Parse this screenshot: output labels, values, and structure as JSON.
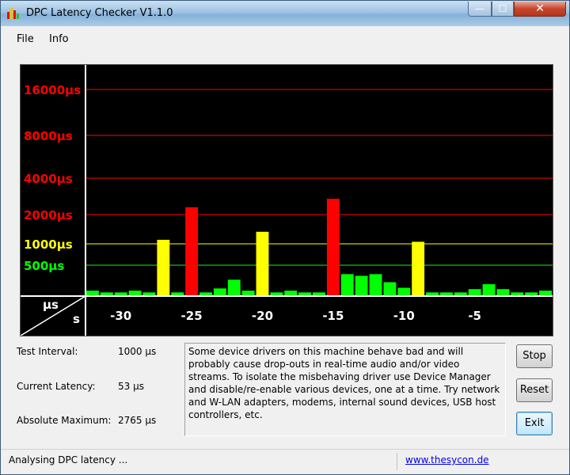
{
  "window": {
    "title": "DPC Latency Checker V1.1.0"
  },
  "window_controls": {
    "minimize": "—",
    "maximize": "☐",
    "close": "✕"
  },
  "menu": [
    "File",
    "Info"
  ],
  "chart_data": {
    "type": "bar",
    "ylabel": "µs",
    "xlabel": "s",
    "yscale": "log",
    "grid": true,
    "gridlines": [
      {
        "label": "16000µs",
        "value": 16000,
        "color": "#ff0000"
      },
      {
        "label": "8000µs",
        "value": 8000,
        "color": "#ff0000"
      },
      {
        "label": "4000µs",
        "value": 4000,
        "color": "#ff0000"
      },
      {
        "label": "2000µs",
        "value": 2000,
        "color": "#ff0000"
      },
      {
        "label": "1000µs",
        "value": 1000,
        "color": "#ffff00"
      },
      {
        "label": "500µs",
        "value": 500,
        "color": "#00ff00"
      }
    ],
    "x_ticks": [
      {
        "label": "-30",
        "value": -30
      },
      {
        "label": "-25",
        "value": -25
      },
      {
        "label": "-20",
        "value": -20
      },
      {
        "label": "-15",
        "value": -15
      },
      {
        "label": "-10",
        "value": -10
      },
      {
        "label": "-5",
        "value": -5
      }
    ],
    "xlim": [
      -32.5,
      0.5
    ],
    "x": [
      -32,
      -31,
      -30,
      -29,
      -28,
      -27,
      -26,
      -25,
      -24,
      -23,
      -22,
      -21,
      -20,
      -19,
      -18,
      -17,
      -16,
      -15,
      -14,
      -13,
      -12,
      -11,
      -10,
      -9,
      -8,
      -7,
      -6,
      -5,
      -4,
      -3,
      -2,
      -1,
      0
    ],
    "values": [
      70,
      60,
      60,
      70,
      60,
      1100,
      60,
      2300,
      60,
      85,
      170,
      70,
      1330,
      60,
      70,
      60,
      60,
      2700,
      260,
      230,
      260,
      140,
      90,
      1050,
      60,
      60,
      60,
      80,
      120,
      80,
      60,
      60,
      70
    ],
    "colors": {
      "green": "#00ff00",
      "yellow": "#ffff00",
      "red": "#ff0000",
      "axis": "#ffffff",
      "background": "#000000"
    },
    "thresholds": {
      "yellow": 1000,
      "red": 2000
    }
  },
  "info": {
    "test_interval_label": "Test Interval:",
    "test_interval_value": "1000 µs",
    "current_latency_label": "Current Latency:",
    "current_latency_value": "53 µs",
    "absolute_maximum_label": "Absolute Maximum:",
    "absolute_maximum_value": "2765 µs"
  },
  "message": "Some device drivers on this machine behave bad and will probably cause drop-outs in real-time audio and/or video streams. To isolate the misbehaving driver use Device Manager and disable/re-enable various devices, one at a time. Try network and W-LAN adapters, modems, internal sound devices, USB host controllers, etc.",
  "buttons": {
    "stop": "Stop",
    "reset": "Reset",
    "exit": "Exit"
  },
  "status": {
    "text": "Analysing DPC latency ...",
    "link": "www.thesycon.de"
  }
}
